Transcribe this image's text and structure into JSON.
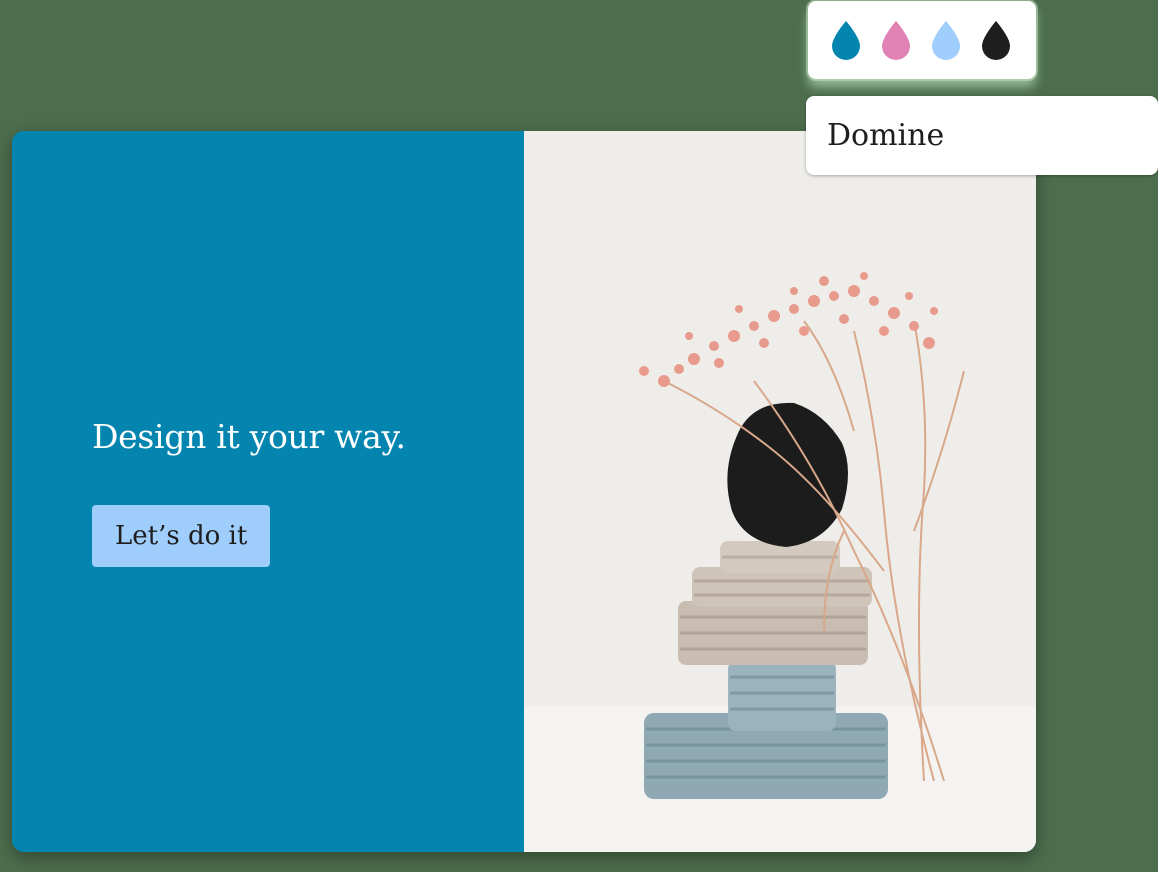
{
  "colors": {
    "page_background": "#4d6e4d",
    "panel_primary": "#0385b0",
    "headline_text": "#ffffff",
    "button_background": "#9fcdfc",
    "button_text": "#1e1e1e",
    "photo_background": "#efedea"
  },
  "hero": {
    "headline": "Design it your way.",
    "cta_label": "Let’s do it"
  },
  "photo": {
    "icon": "clay-sculpture-with-dried-flowers-image"
  },
  "palette": {
    "swatches": [
      {
        "name": "blue",
        "color": "#0385b0",
        "icon": "drop-icon"
      },
      {
        "name": "pink",
        "color": "#e083b4",
        "icon": "drop-icon"
      },
      {
        "name": "light-blue",
        "color": "#9fcdfc",
        "icon": "drop-icon"
      },
      {
        "name": "black",
        "color": "#1e1e1e",
        "icon": "drop-icon"
      }
    ]
  },
  "font_picker": {
    "value": "Domine"
  }
}
